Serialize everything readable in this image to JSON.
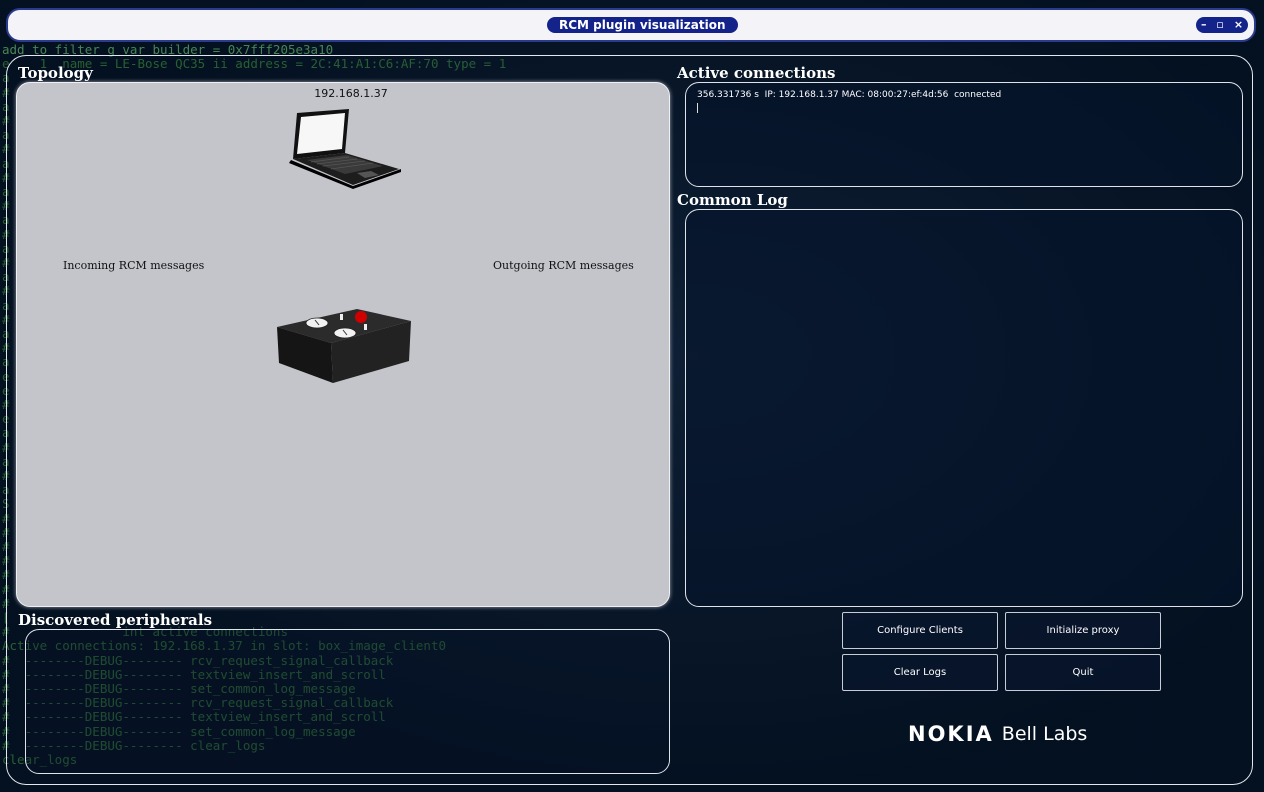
{
  "terminal": {
    "lines": [
      "add to filter g var builder = 0x7fff205e3a10",
      "e    1  name = LE-Bose QC35 ii address = 2C:41:A1:C6:AF:70 type = 1",
      "a",
      "#",
      "a",
      "#",
      "a",
      "#",
      "a",
      "#",
      "a",
      "#",
      "a",
      "#",
      "a",
      "#",
      "a",
      "#",
      "a",
      "#",
      "a",
      "#",
      "a",
      "e",
      "e",
      "#",
      "e",
      "a",
      "#",
      "a",
      "#",
      "a",
      "S",
      "#",
      "#",
      "#",
      "#",
      "#",
      "#",
      "#",
      "[",
      "#               int active connections",
      "Active connections: 192.168.1.37 in slot: box_image_client0",
      "#  --------DEBUG-------- rcv_request_signal_callback",
      "#  --------DEBUG-------- textview_insert_and_scroll",
      "#  --------DEBUG-------- set_common_log_message",
      "#  --------DEBUG-------- rcv_request_signal_callback",
      "#  --------DEBUG-------- textview_insert_and_scroll",
      "#  --------DEBUG-------- set_common_log_message",
      "#  --------DEBUG-------- clear_logs",
      "clear_logs"
    ]
  },
  "window": {
    "title": "RCM plugin visualization",
    "minimize": "–",
    "maximize": "▫",
    "close": "×"
  },
  "topology": {
    "title": "Topology",
    "laptop_ip": "192.168.1.37",
    "incoming_label": "Incoming RCM messages",
    "outgoing_label": "Outgoing RCM messages"
  },
  "active_connections": {
    "title": "Active connections",
    "entry": "356.331736 s  IP: 192.168.1.37 MAC: 08:00:27:ef:4d:56  connected"
  },
  "common_log": {
    "title": "Common Log"
  },
  "peripherals": {
    "title": "Discovered peripherals"
  },
  "buttons": {
    "configure_clients": "Configure Clients",
    "initialize_proxy": "Initialize proxy",
    "clear_logs": "Clear Logs",
    "quit": "Quit"
  },
  "logo": {
    "brand": "NOKIA",
    "suffix": "Bell Labs"
  },
  "colors": {
    "title_pill": "#14238a",
    "topology_bg": "#c3c5cb",
    "window_bg": "#0a1a2e",
    "terminal_text": "#3a8a3a"
  }
}
